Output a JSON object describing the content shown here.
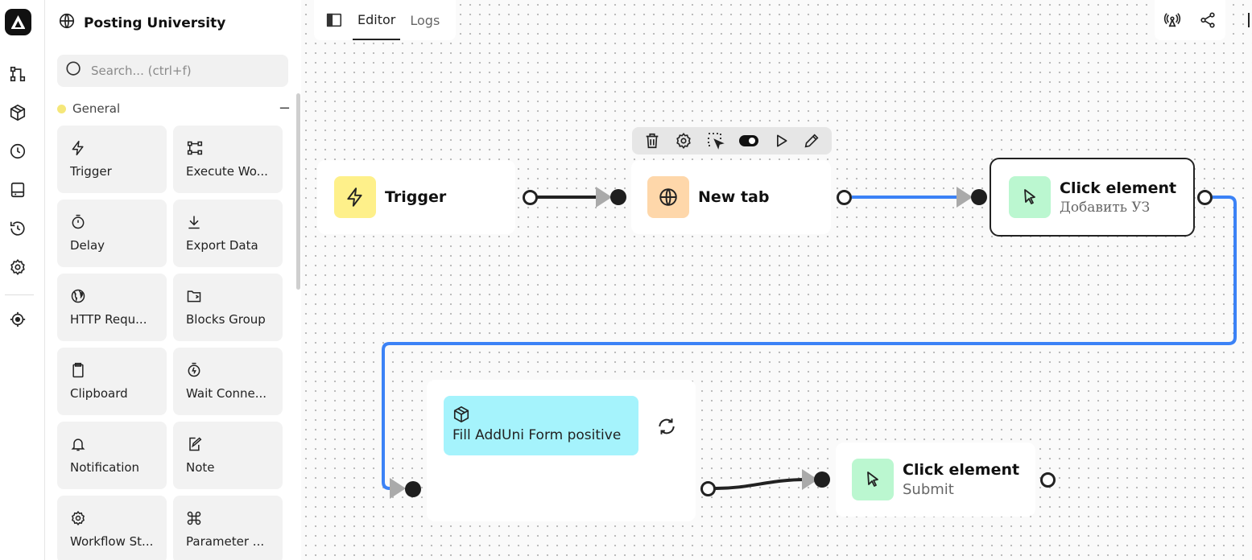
{
  "workspace": {
    "title": "Posting University"
  },
  "rail": {
    "items": [
      {
        "name": "workflows-icon"
      },
      {
        "name": "packages-icon"
      },
      {
        "name": "schedule-icon"
      },
      {
        "name": "storage-icon"
      },
      {
        "name": "history-icon"
      },
      {
        "name": "settings-icon"
      },
      {
        "name": "recording-icon"
      }
    ]
  },
  "search": {
    "placeholder": "Search... (ctrl+f)"
  },
  "category": {
    "label": "General",
    "collapse": "−",
    "color": "#f5e77a"
  },
  "blocks": [
    {
      "label": "Trigger",
      "icon": "lightning-icon"
    },
    {
      "label": "Execute Wo...",
      "icon": "execute-workflow-icon"
    },
    {
      "label": "Delay",
      "icon": "stopwatch-icon"
    },
    {
      "label": "Export Data",
      "icon": "download-icon"
    },
    {
      "label": "HTTP Requ...",
      "icon": "globe-icon"
    },
    {
      "label": "Blocks Group",
      "icon": "folder-icon"
    },
    {
      "label": "Clipboard",
      "icon": "clipboard-icon"
    },
    {
      "label": "Wait Conne...",
      "icon": "timer-icon"
    },
    {
      "label": "Notification",
      "icon": "bell-icon"
    },
    {
      "label": "Note",
      "icon": "note-icon"
    },
    {
      "label": "Workflow St...",
      "icon": "gear-icon"
    },
    {
      "label": "Parameter ...",
      "icon": "command-icon"
    }
  ],
  "tabs": [
    {
      "label": "Editor",
      "active": true
    },
    {
      "label": "Logs",
      "active": false
    }
  ],
  "nodes": {
    "trigger": {
      "title": "Trigger",
      "color": "#fef08a"
    },
    "new_tab": {
      "title": "New tab",
      "color": "#fed7aa"
    },
    "click1": {
      "title": "Click element",
      "subtitle": "Добавить УЗ",
      "color": "#bbf7d0"
    },
    "group": {
      "label": "Fill AddUni Form positive",
      "color": "#a5f3fc"
    },
    "click2": {
      "title": "Click element",
      "subtitle": "Submit",
      "color": "#bbf7d0"
    }
  },
  "colors": {
    "accent_wire": "#3b82f6",
    "dark_wire": "#222222"
  }
}
